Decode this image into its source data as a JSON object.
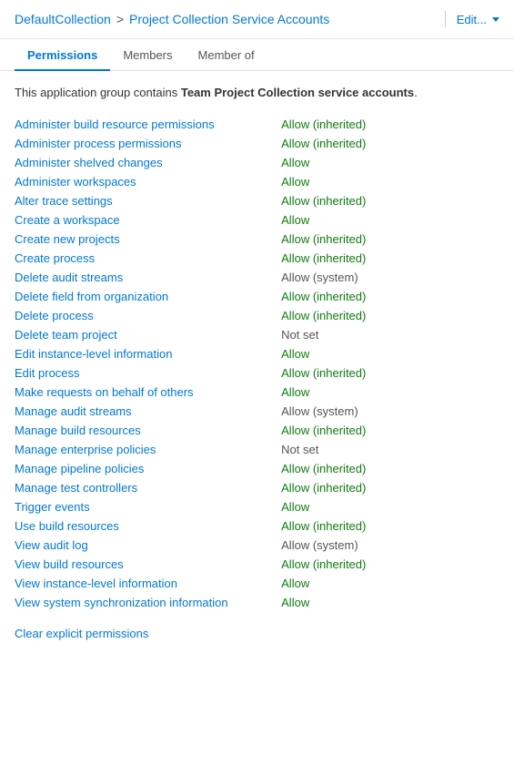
{
  "header": {
    "collection": "DefaultCollection",
    "separator": ">",
    "page_title": "Project Collection Service Accounts",
    "edit_label": "Edit...",
    "chevron_icon": "chevron-down"
  },
  "tabs": [
    {
      "id": "permissions",
      "label": "Permissions",
      "active": true
    },
    {
      "id": "members",
      "label": "Members",
      "active": false
    },
    {
      "id": "member-of",
      "label": "Member of",
      "active": false
    }
  ],
  "description": {
    "text_start": "This application group contains ",
    "highlight": "Team Project Collection service accounts",
    "text_end": "."
  },
  "permissions": [
    {
      "name": "Administer build resource permissions",
      "value": "Allow (inherited)",
      "type": "allow-inherited"
    },
    {
      "name": "Administer process permissions",
      "value": "Allow (inherited)",
      "type": "allow-inherited"
    },
    {
      "name": "Administer shelved changes",
      "value": "Allow",
      "type": "allow"
    },
    {
      "name": "Administer workspaces",
      "value": "Allow",
      "type": "allow"
    },
    {
      "name": "Alter trace settings",
      "value": "Allow (inherited)",
      "type": "allow-inherited"
    },
    {
      "name": "Create a workspace",
      "value": "Allow",
      "type": "allow"
    },
    {
      "name": "Create new projects",
      "value": "Allow (inherited)",
      "type": "allow-inherited"
    },
    {
      "name": "Create process",
      "value": "Allow (inherited)",
      "type": "allow-inherited"
    },
    {
      "name": "Delete audit streams",
      "value": "Allow (system)",
      "type": "allow-system"
    },
    {
      "name": "Delete field from organization",
      "value": "Allow (inherited)",
      "type": "allow-inherited"
    },
    {
      "name": "Delete process",
      "value": "Allow (inherited)",
      "type": "allow-inherited"
    },
    {
      "name": "Delete team project",
      "value": "Not set",
      "type": "not-set"
    },
    {
      "name": "Edit instance-level information",
      "value": "Allow",
      "type": "allow"
    },
    {
      "name": "Edit process",
      "value": "Allow (inherited)",
      "type": "allow-inherited"
    },
    {
      "name": "Make requests on behalf of others",
      "value": "Allow",
      "type": "allow"
    },
    {
      "name": "Manage audit streams",
      "value": "Allow (system)",
      "type": "allow-system"
    },
    {
      "name": "Manage build resources",
      "value": "Allow (inherited)",
      "type": "allow-inherited"
    },
    {
      "name": "Manage enterprise policies",
      "value": "Not set",
      "type": "not-set"
    },
    {
      "name": "Manage pipeline policies",
      "value": "Allow (inherited)",
      "type": "allow-inherited"
    },
    {
      "name": "Manage test controllers",
      "value": "Allow (inherited)",
      "type": "allow-inherited"
    },
    {
      "name": "Trigger events",
      "value": "Allow",
      "type": "allow"
    },
    {
      "name": "Use build resources",
      "value": "Allow (inherited)",
      "type": "allow-inherited"
    },
    {
      "name": "View audit log",
      "value": "Allow (system)",
      "type": "allow-system"
    },
    {
      "name": "View build resources",
      "value": "Allow (inherited)",
      "type": "allow-inherited"
    },
    {
      "name": "View instance-level information",
      "value": "Allow",
      "type": "allow"
    },
    {
      "name": "View system synchronization information",
      "value": "Allow",
      "type": "allow"
    }
  ],
  "clear_label": "Clear explicit permissions"
}
